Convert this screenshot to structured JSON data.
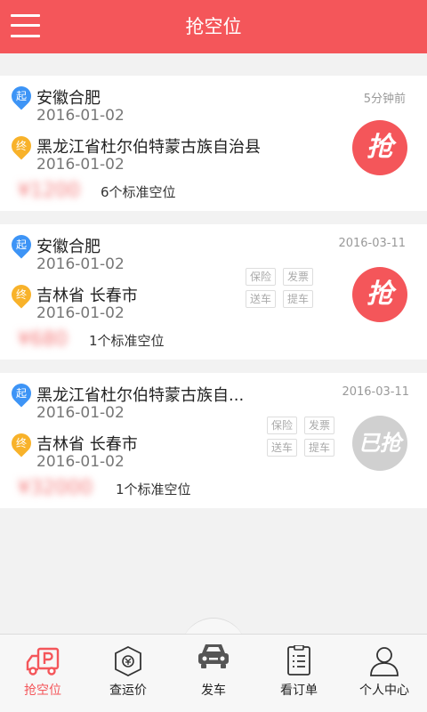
{
  "header": {
    "title": "抢空位"
  },
  "orders": [
    {
      "from": {
        "tag": "起",
        "place": "安徽合肥",
        "date": "2016-01-02"
      },
      "to": {
        "tag": "终",
        "place": "黑龙江省杜尔伯特蒙古族自治县",
        "date": "2016-01-02"
      },
      "meta": "5分钟前",
      "price": "¥1200",
      "count": "6个标准空位",
      "tags": [],
      "action": "抢"
    },
    {
      "from": {
        "tag": "起",
        "place": "安徽合肥",
        "date": "2016-01-02"
      },
      "to": {
        "tag": "终",
        "place": "吉林省 长春市",
        "date": "2016-01-02"
      },
      "meta": "2016-03-11",
      "price": "¥680",
      "count": "1个标准空位",
      "tags": [
        "保险",
        "发票",
        "送车",
        "提车"
      ],
      "action": "抢"
    },
    {
      "from": {
        "tag": "起",
        "place": "黑龙江省杜尔伯特蒙古族自...",
        "date": "2016-01-02"
      },
      "to": {
        "tag": "终",
        "place": "吉林省 长春市",
        "date": "2016-01-02"
      },
      "meta": "2016-03-11",
      "price": "¥32000",
      "count": "1个标准空位",
      "tags": [
        "保险",
        "发票",
        "送车",
        "提车"
      ],
      "action": "已抢"
    }
  ],
  "tabs": [
    {
      "label": "抢空位",
      "icon": "truck-parking-icon",
      "active": true
    },
    {
      "label": "查运价",
      "icon": "price-tag-icon",
      "active": false
    },
    {
      "label": "发车",
      "icon": "car-icon",
      "active": false
    },
    {
      "label": "看订单",
      "icon": "order-list-icon",
      "active": false
    },
    {
      "label": "个人中心",
      "icon": "user-icon",
      "active": false
    }
  ],
  "colors": {
    "brand": "#f4565a",
    "start_pin": "#3d94f6",
    "end_pin": "#f8b22a",
    "disabled": "#d0d0d0"
  }
}
